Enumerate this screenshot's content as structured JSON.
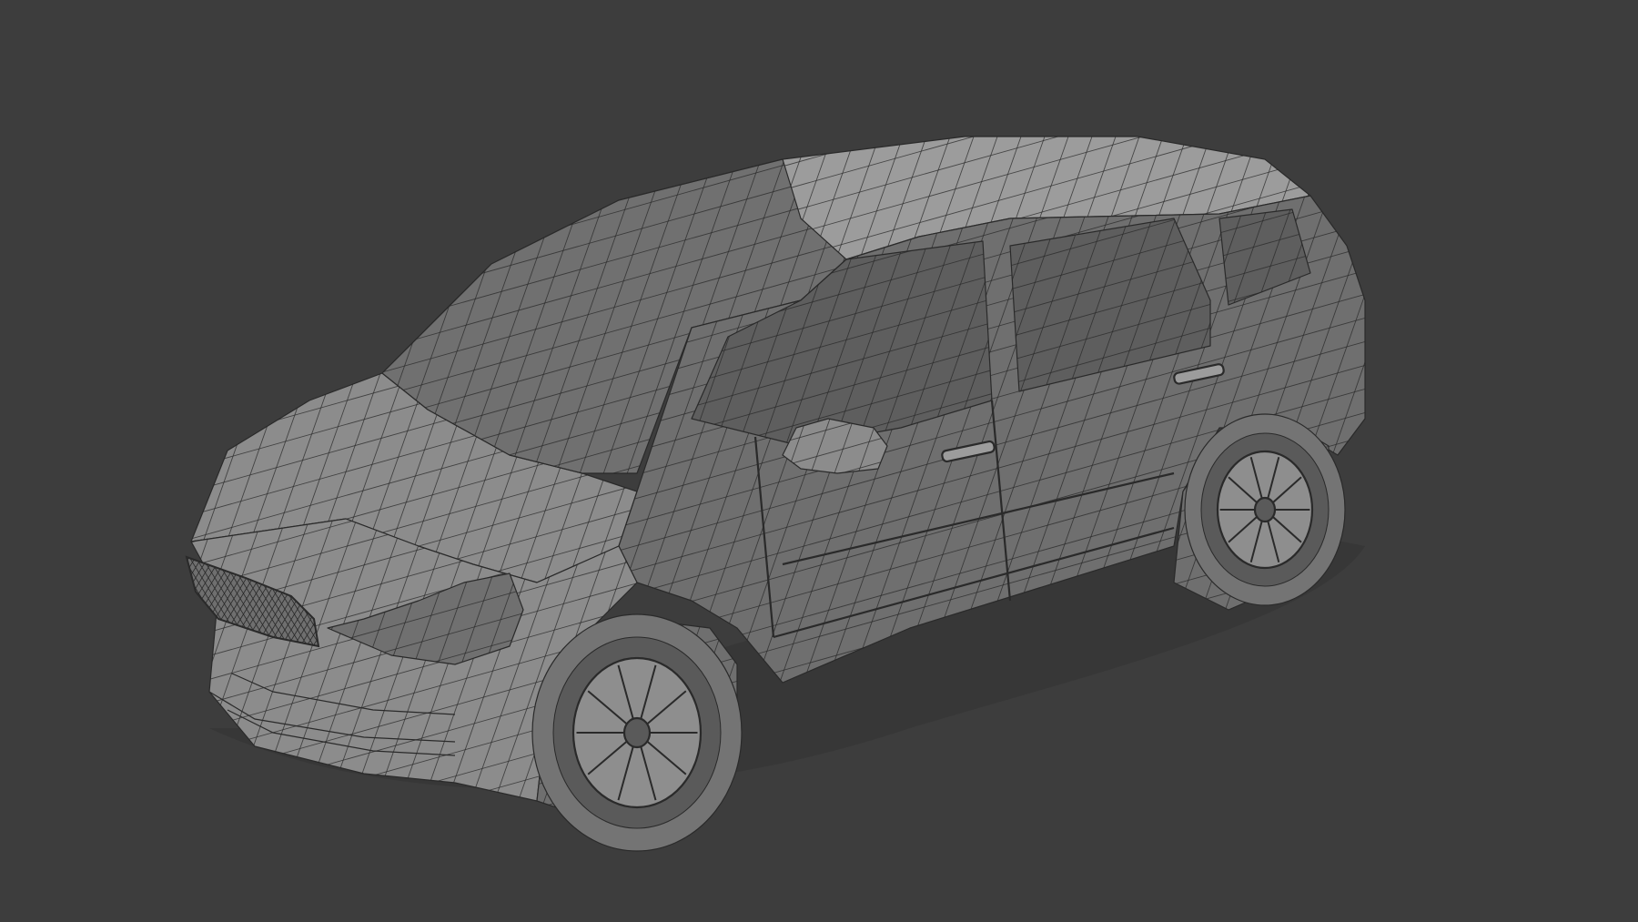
{
  "viewport": {
    "background_color": "#3d3d3d",
    "shading": "solid-wireframe",
    "subject": "car-model"
  },
  "colors": {
    "body": "#8c8c8c",
    "body_light": "#9c9c9c",
    "body_dark": "#6f6f6f",
    "glass": "#707070",
    "glass_dark": "#5e5e5e",
    "wire": "#2a2a2a",
    "tire": "#747474",
    "tire_dark": "#5a5a5a",
    "rim": "#8e8e8e",
    "shadow": "#333333"
  }
}
